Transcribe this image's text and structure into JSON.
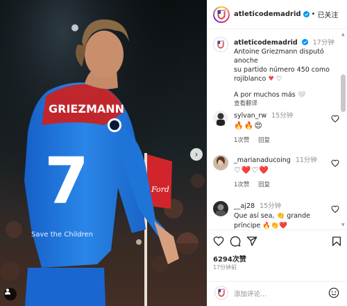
{
  "header": {
    "username": "atleticodemadrid",
    "follow_state": "已关注",
    "separator": "•"
  },
  "caption": {
    "username": "atleticodemadrid",
    "time": "17分钟",
    "text_line1": "Antoine Griezmann disputó anoche",
    "text_line2": "su partido número 450 como",
    "text_line3": "rojiblanco",
    "text_line4": "A por muchos más 🤍",
    "see_translation": "查看翻译"
  },
  "photo": {
    "shirt_name": "GRIEZMANN",
    "shirt_number": "7",
    "sponsor": "Save the Children",
    "flag_logo": "Ford"
  },
  "comments": [
    {
      "username": "sylvan_rw",
      "time": "15分钟",
      "text": "🔥🔥😍",
      "likes": "1次赞",
      "reply": "回复"
    },
    {
      "username": "_marianaducoing",
      "time": "11分钟",
      "text": "♡❤️♡❤️",
      "likes": "1次赞",
      "reply": "回复"
    },
    {
      "username": "__aj28",
      "time": "15分钟",
      "text_line1": "Que así sea, 👏 grande",
      "text_line2": "príncipe 🔥👏❤️"
    }
  ],
  "actions": {
    "likes": "6294次赞",
    "time_ago": "17分钟前",
    "comment_placeholder": "添加评论..."
  },
  "colors": {
    "accent_red": "#ed4956",
    "verified_blue": "#0095f6",
    "kit_blue": "#1e7ee0",
    "kit_red": "#c0272d"
  }
}
